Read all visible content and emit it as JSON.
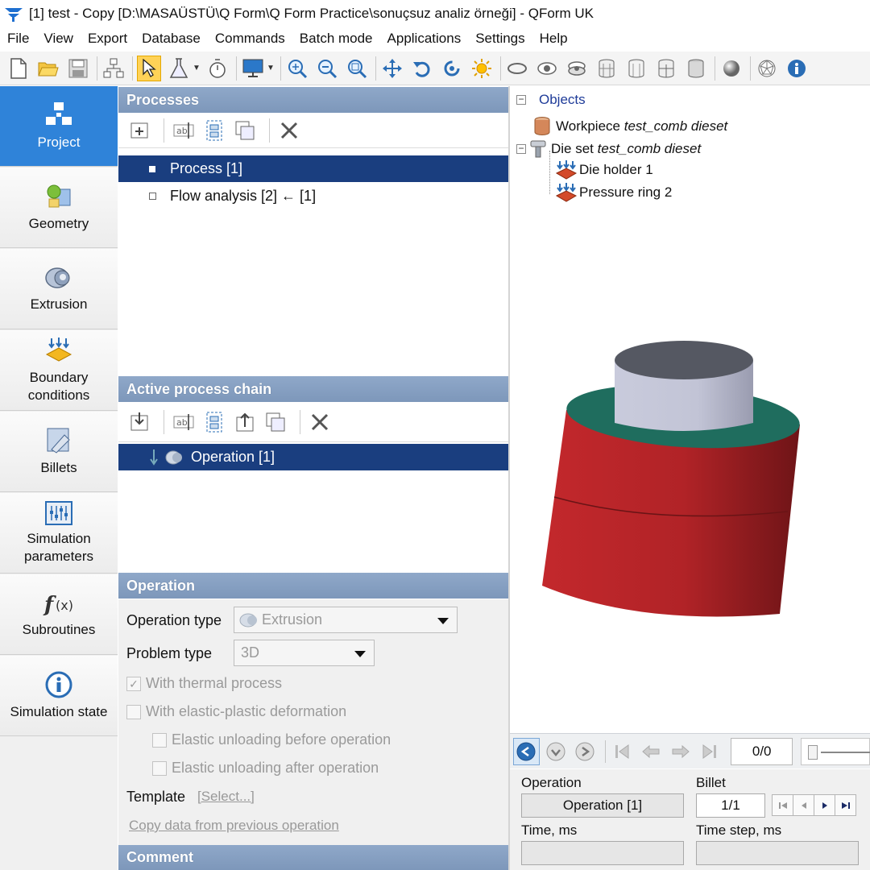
{
  "window": {
    "title": "[1] test - Copy  [D:\\MASAÜSTÜ\\Q Form\\Q Form Practice\\sonuçsuz analiz örneği] - QForm UK"
  },
  "menu": [
    "File",
    "View",
    "Export",
    "Database",
    "Commands",
    "Batch mode",
    "Applications",
    "Settings",
    "Help"
  ],
  "toolbar_icons": [
    "new-file-icon",
    "open-folder-icon",
    "save-icon",
    "hierarchy-icon",
    "pointer-icon",
    "flask-icon",
    "stopwatch-icon",
    "monitor-icon",
    "zoom-fit-icon",
    "zoom-out-icon",
    "zoom-window-icon",
    "pan-icon",
    "undo-rotate-icon",
    "rotate-icon",
    "light-icon",
    "ring-view-icon",
    "eye-icon",
    "eye-layers-icon",
    "cylinder-mesh-icon",
    "cylinder-icon",
    "cylinder-section-icon",
    "cylinder-solid-icon",
    "sphere-icon",
    "mesh-sphere-icon",
    "info-icon"
  ],
  "sidebar": [
    {
      "label": "Project",
      "icon": "project-icon",
      "active": true
    },
    {
      "label": "Geometry",
      "icon": "geometry-icon"
    },
    {
      "label": "Extrusion",
      "icon": "extrusion-icon"
    },
    {
      "label": "Boundary conditions",
      "icon": "boundary-conditions-icon"
    },
    {
      "label": "Billets",
      "icon": "billets-icon"
    },
    {
      "label": "Simulation parameters",
      "icon": "simulation-parameters-icon"
    },
    {
      "label": "Subroutines",
      "icon": "subroutines-icon"
    },
    {
      "label": "Simulation state",
      "icon": "simulation-state-icon"
    }
  ],
  "processes": {
    "header": "Processes",
    "items": [
      "Process [1]",
      "Flow analysis [2] ← [1]"
    ]
  },
  "chain": {
    "header": "Active process chain",
    "items": [
      "Operation [1]"
    ]
  },
  "operation": {
    "header": "Operation",
    "operation_type_label": "Operation type",
    "operation_type_value": "Extrusion",
    "problem_type_label": "Problem type",
    "problem_type_value": "3D",
    "thermal": "With thermal process",
    "elastic": "With elastic-plastic deformation",
    "unload_before": "Elastic unloading before operation",
    "unload_after": "Elastic unloading after operation",
    "template_label": "Template",
    "template_link": "[Select...]",
    "copy_link": "Copy data from previous operation"
  },
  "comment": {
    "header": "Comment"
  },
  "objects": {
    "root": "Objects",
    "workpiece_label": "Workpiece",
    "workpiece_name": "test_comb dieset",
    "dieset_label": "Die set",
    "dieset_name": "test_comb dieset",
    "die_holder": "Die holder 1",
    "pressure_ring": "Pressure ring 2"
  },
  "playback": {
    "step": "0/0"
  },
  "info": {
    "operation_label": "Operation",
    "operation_value": "Operation [1]",
    "billet_label": "Billet",
    "billet_value": "1/1",
    "time_label": "Time, ms",
    "timestep_label": "Time step, ms"
  },
  "colors": {
    "accent": "#2f83d9",
    "selection": "#1a3e7f",
    "header": "#8aa3c4",
    "ring": "#b3272b",
    "workpiece": "#c9ccdc",
    "top_face": "#1f6d5e"
  }
}
